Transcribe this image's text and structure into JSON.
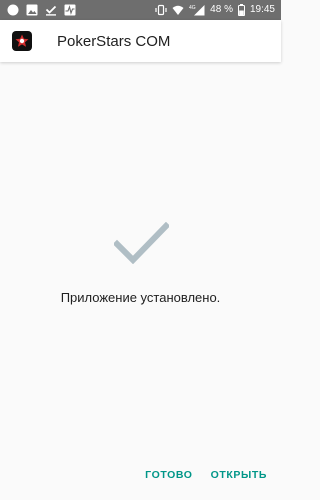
{
  "status_bar": {
    "battery_percent": "48 %",
    "time": "19:45",
    "signal_label": "4G",
    "icons": [
      "circle-icon",
      "image-icon",
      "download-done-icon",
      "activity-icon",
      "vibrate-icon",
      "wifi-icon",
      "signal-icon",
      "battery-icon"
    ]
  },
  "app_bar": {
    "title": "PokerStars COM",
    "icon": "pokerstars-logo-icon"
  },
  "content": {
    "check_icon": "checkmark-icon",
    "check_color": "#b0bec5",
    "message": "Приложение установлено."
  },
  "actions": {
    "done_label": "ГОТОВО",
    "open_label": "ОТКРЫТЬ",
    "accent_color": "#009688"
  }
}
